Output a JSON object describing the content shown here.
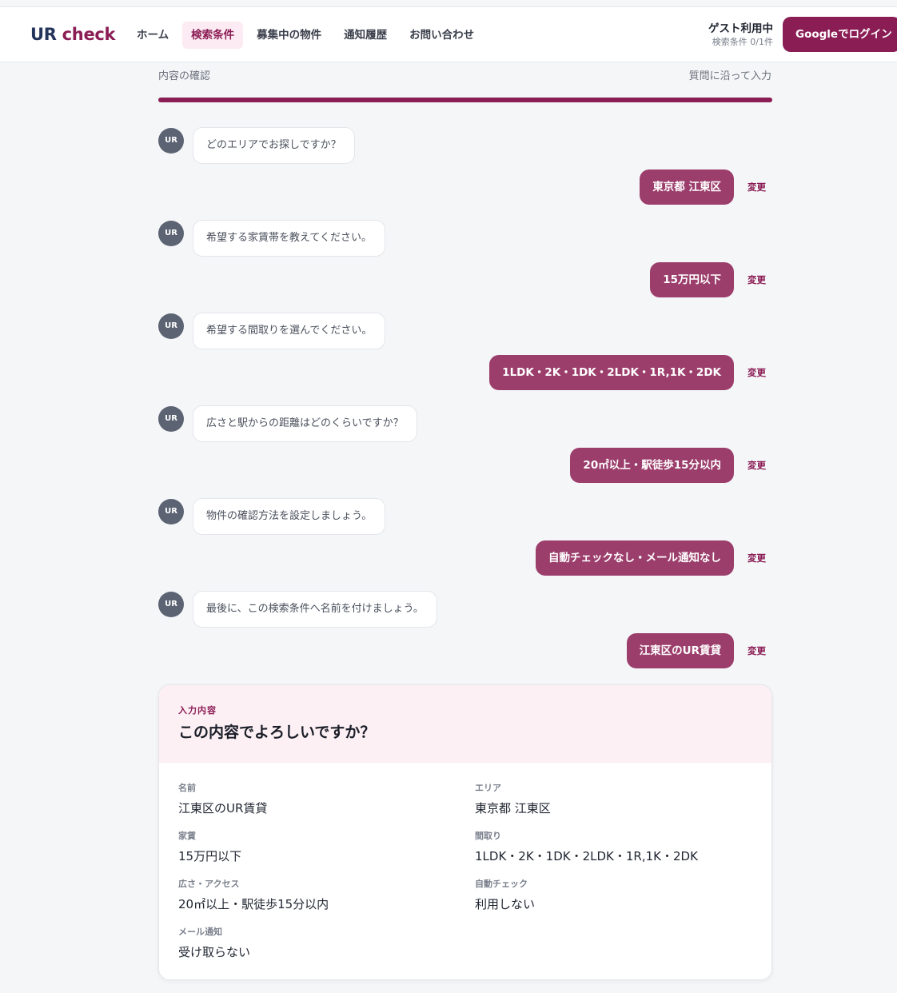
{
  "app": {
    "logo_primary": "UR",
    "logo_secondary": "check"
  },
  "nav": {
    "items": [
      {
        "label": "ホーム"
      },
      {
        "label": "検索条件"
      },
      {
        "label": "募集中の物件"
      },
      {
        "label": "通知履歴"
      },
      {
        "label": "お問い合わせ"
      }
    ],
    "active_index": 1
  },
  "account": {
    "status": "ゲスト利用中",
    "quota": "検索条件 0/1件",
    "login_label": "Googleでログイン"
  },
  "progress": {
    "step_label": "内容の確認",
    "right_label": "質問に沿って入力",
    "percent": 100
  },
  "chat": {
    "avatar_label": "UR",
    "change_label": "変更",
    "turns": [
      {
        "question": "どのエリアでお探しですか？",
        "answer": "東京都 江東区"
      },
      {
        "question": "希望する家賃帯を教えてください。",
        "answer": "15万円以下"
      },
      {
        "question": "希望する間取りを選んでください。",
        "answer": "1LDK・2K・1DK・2LDK・1R,1K・2DK"
      },
      {
        "question": "広さと駅からの距離はどのくらいですか？",
        "answer": "20㎡以上・駅徒歩15分以内"
      },
      {
        "question": "物件の確認方法を設定しましょう。",
        "answer": "自動チェックなし・メール通知なし"
      },
      {
        "question": "最後に、この検索条件へ名前を付けましょう。",
        "answer": "江東区のUR賃貸"
      }
    ]
  },
  "summary": {
    "eyebrow": "入力内容",
    "title": "この内容でよろしいですか？",
    "fields": {
      "name": {
        "label": "名前",
        "value": "江東区のUR賃貸"
      },
      "area": {
        "label": "エリア",
        "value": "東京都 江東区"
      },
      "rent": {
        "label": "家賃",
        "value": "15万円以下"
      },
      "layout": {
        "label": "間取り",
        "value": "1LDK・2K・1DK・2LDK・1R,1K・2DK"
      },
      "size_access": {
        "label": "広さ・アクセス",
        "value": "20㎡以上・駅徒歩15分以内"
      },
      "auto_check": {
        "label": "自動チェック",
        "value": "利用しない"
      },
      "mail_notice": {
        "label": "メール通知",
        "value": "受け取らない"
      }
    }
  },
  "colors": {
    "brand": "#8b1d55",
    "answer_bubble": "#9c3e6c",
    "logo_ur": "#23355a",
    "summary_header_bg": "#fdf0f4"
  }
}
